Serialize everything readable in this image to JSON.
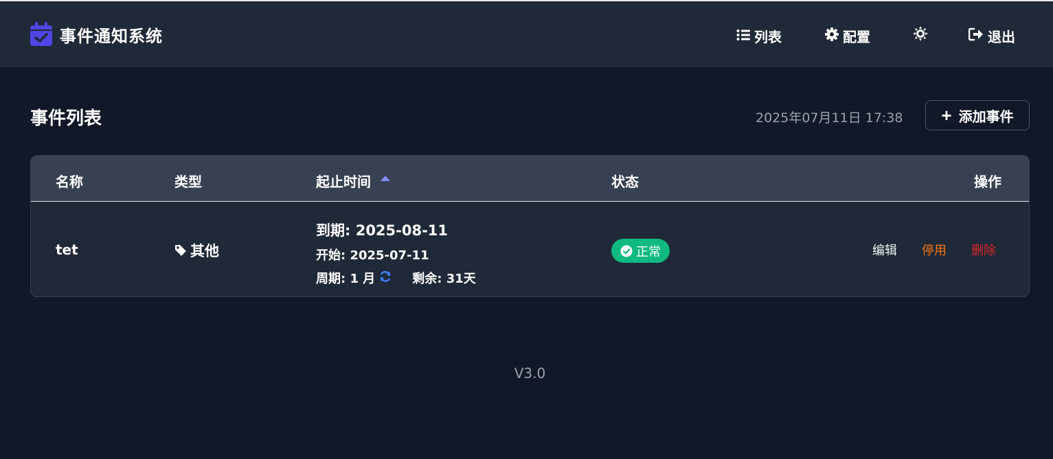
{
  "colors": {
    "page_bg": "#111827",
    "header_bg": "#1f2937",
    "accent": "#4f46e5",
    "status_ok": "#10b981",
    "disable": "#f97316",
    "delete": "#dc2626"
  },
  "header": {
    "brand_icon": "calendar-check-icon",
    "title": "事件通知系统",
    "nav": {
      "list": {
        "icon": "list-icon",
        "label": "列表"
      },
      "config": {
        "icon": "gear-icon",
        "label": "配置"
      },
      "theme": {
        "icon": "sun-icon",
        "label": ""
      },
      "logout": {
        "icon": "sign-out-icon",
        "label": "退出"
      }
    }
  },
  "main": {
    "title": "事件列表",
    "datetime": "2025年07月11日 17:38",
    "add_button": "添加事件"
  },
  "table": {
    "columns": {
      "name": "名称",
      "type": "类型",
      "time": "起止时间",
      "status": "状态",
      "ops": "操作"
    },
    "rows": [
      {
        "name": "tet",
        "type": "其他",
        "type_icon": "tag-icon",
        "due": "到期: 2025-08-11",
        "start": "开始: 2025-07-11",
        "cycle": "周期: 1 月",
        "cycle_icon": "refresh-icon",
        "remaining": "剩余: 31天",
        "status": "正常",
        "status_icon": "check-circle-icon",
        "actions": {
          "edit": "编辑",
          "disable": "停用",
          "delete": "删除"
        }
      }
    ]
  },
  "footer": {
    "version": "V3.0"
  }
}
